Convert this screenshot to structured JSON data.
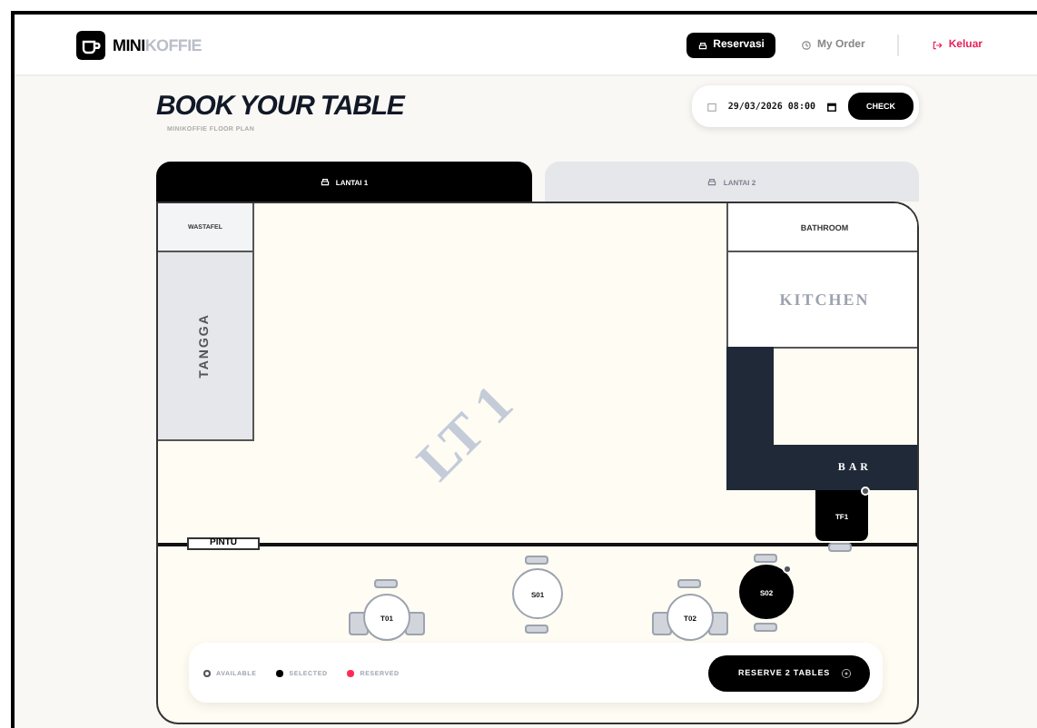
{
  "header": {
    "brand": {
      "bold": "MINI",
      "light": "KOFFIE"
    },
    "nav": [
      {
        "kind": "nav",
        "label": "Reservasi",
        "selected": true
      },
      {
        "kind": "nav",
        "label": "My Order",
        "selected": false
      },
      {
        "kind": "logout",
        "label": "Keluar"
      }
    ]
  },
  "title": "BOOK YOUR TABLE",
  "subtitle": "MINIKOFFIE FLOOR PLAN",
  "date_field": {
    "value": "29/03/2026 08:00"
  },
  "check_button": "CHECK",
  "tabs": [
    {
      "label": "LANTAI 1",
      "selected": true
    },
    {
      "label": "LANTAI 2",
      "selected": false
    }
  ],
  "floor": {
    "watermark": "LT 1",
    "rooms": [
      {
        "kind": "wastafel",
        "label": "WASTAFEL"
      },
      {
        "kind": "tangga",
        "label": "TANGGA"
      },
      {
        "kind": "bathroom",
        "label": "BATHROOM"
      },
      {
        "kind": "kitchen",
        "label": "KITCHEN"
      },
      {
        "kind": "bar",
        "label": "BAR"
      },
      {
        "kind": "pintu",
        "label": "PINTU"
      }
    ],
    "tables": [
      {
        "label": "TF1",
        "kind": "square",
        "selected": true
      },
      {
        "label": "S01",
        "kind": "round",
        "selected": false
      },
      {
        "label": "S02",
        "kind": "round",
        "selected": true
      },
      {
        "label": "T01",
        "kind": "wide",
        "selected": false
      },
      {
        "label": "T02",
        "kind": "wide",
        "selected": false
      }
    ]
  },
  "legend": [
    {
      "kind": "available",
      "label": "AVAILABLE"
    },
    {
      "kind": "selected",
      "label": "SELECTED"
    },
    {
      "kind": "reserved",
      "label": "RESERVED"
    }
  ],
  "reserve_button": "RESERVE 2 TABLES"
}
